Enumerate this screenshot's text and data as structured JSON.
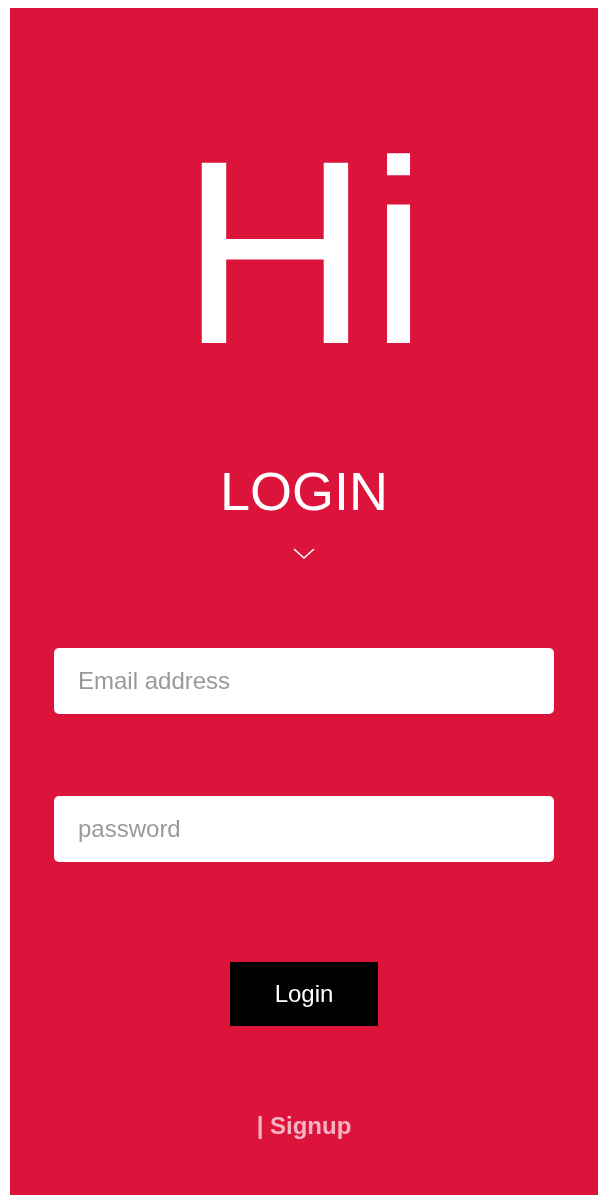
{
  "greeting": "Hi",
  "heading": "LOGIN",
  "fields": [
    {
      "placeholder": "Email address"
    },
    {
      "placeholder": "password"
    }
  ],
  "submit": "Login",
  "signup_link": "| Signup"
}
